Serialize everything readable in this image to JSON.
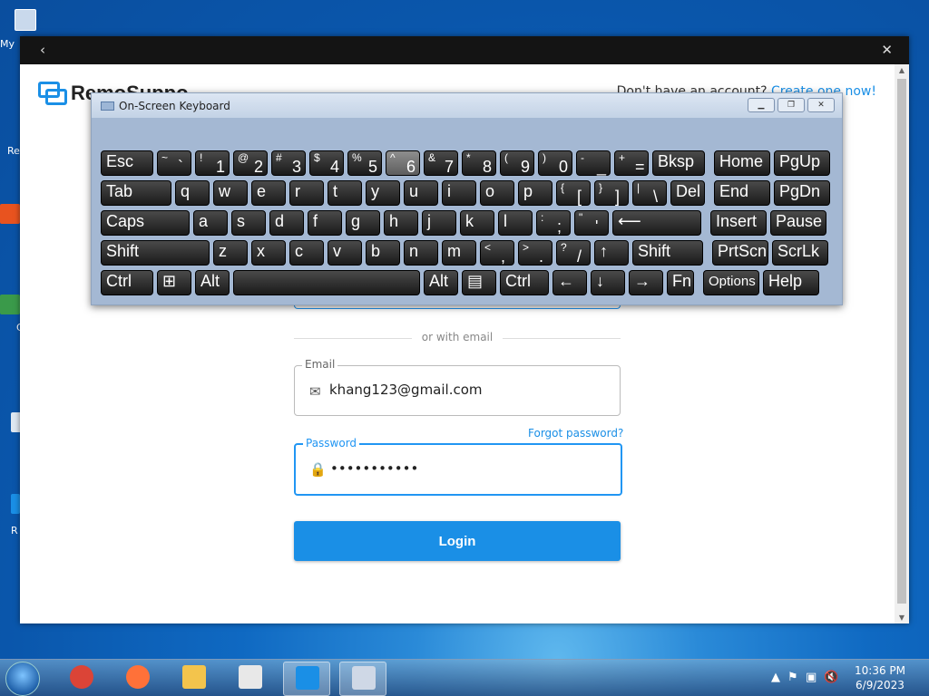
{
  "desktop": {
    "icons": [
      {
        "label": "My"
      },
      {
        "label": "Re"
      },
      {
        "label": ""
      },
      {
        "label": "C"
      },
      {
        "label": ""
      },
      {
        "label": "R"
      }
    ]
  },
  "app": {
    "back_glyph": "‹",
    "close_glyph": "✕",
    "brand": "RemoSuppo",
    "signup_prompt": "Don't have an account?",
    "signup_link": "Create one now!",
    "divider_text": "or with email",
    "email": {
      "label": "Email",
      "value": "khang123@gmail.com",
      "icon": "envelope-icon"
    },
    "forgot_password": "Forgot password?",
    "password": {
      "label": "Password",
      "value": "•••••••••••",
      "icon": "lock-icon"
    },
    "login_label": "Login",
    "accent_color": "#1a8fe6"
  },
  "osk": {
    "title": "On-Screen Keyboard",
    "rows": [
      [
        {
          "m": "Esc"
        },
        {
          "s": "~",
          "b": "`"
        },
        {
          "s": "!",
          "b": "1"
        },
        {
          "s": "@",
          "b": "2"
        },
        {
          "s": "#",
          "b": "3"
        },
        {
          "s": "$",
          "b": "4"
        },
        {
          "s": "%",
          "b": "5"
        },
        {
          "s": "^",
          "b": "6",
          "hover": true
        },
        {
          "s": "&",
          "b": "7"
        },
        {
          "s": "*",
          "b": "8"
        },
        {
          "s": "(",
          "b": "9"
        },
        {
          "s": ")",
          "b": "0"
        },
        {
          "s": "-",
          "b": "_"
        },
        {
          "s": "+",
          "b": "="
        },
        {
          "m": "Bksp"
        },
        {
          "m": "Home"
        },
        {
          "m": "PgUp"
        }
      ],
      [
        {
          "m": "Tab"
        },
        {
          "m": "q"
        },
        {
          "m": "w"
        },
        {
          "m": "e"
        },
        {
          "m": "r"
        },
        {
          "m": "t"
        },
        {
          "m": "y"
        },
        {
          "m": "u"
        },
        {
          "m": "i"
        },
        {
          "m": "o"
        },
        {
          "m": "p"
        },
        {
          "s": "{",
          "b": "["
        },
        {
          "s": "}",
          "b": "]"
        },
        {
          "s": "|",
          "b": "\\"
        },
        {
          "m": "Del"
        },
        {
          "m": "End"
        },
        {
          "m": "PgDn"
        }
      ],
      [
        {
          "m": "Caps"
        },
        {
          "m": "a"
        },
        {
          "m": "s"
        },
        {
          "m": "d"
        },
        {
          "m": "f"
        },
        {
          "m": "g"
        },
        {
          "m": "h"
        },
        {
          "m": "j"
        },
        {
          "m": "k"
        },
        {
          "m": "l"
        },
        {
          "s": ":",
          "b": ";"
        },
        {
          "s": "\"",
          "b": "'"
        },
        {
          "m": "⟵"
        },
        {
          "m": "Insert"
        },
        {
          "m": "Pause"
        }
      ],
      [
        {
          "m": "Shift"
        },
        {
          "m": "z"
        },
        {
          "m": "x"
        },
        {
          "m": "c"
        },
        {
          "m": "v"
        },
        {
          "m": "b"
        },
        {
          "m": "n"
        },
        {
          "m": "m"
        },
        {
          "s": "<",
          "b": ","
        },
        {
          "s": ">",
          "b": "."
        },
        {
          "s": "?",
          "b": "/"
        },
        {
          "m": "↑"
        },
        {
          "m": "Shift"
        },
        {
          "m": "PrtScn"
        },
        {
          "m": "ScrLk"
        }
      ],
      [
        {
          "m": "Ctrl"
        },
        {
          "m": "⊞"
        },
        {
          "m": "Alt"
        },
        {
          "m": ""
        },
        {
          "m": "Alt"
        },
        {
          "m": "▤"
        },
        {
          "m": "Ctrl"
        },
        {
          "m": "←"
        },
        {
          "m": "↓"
        },
        {
          "m": "→"
        },
        {
          "m": "Fn"
        },
        {
          "m": "Options",
          "small": true
        },
        {
          "m": "Help"
        }
      ]
    ]
  },
  "taskbar": {
    "apps": [
      {
        "name": "chrome",
        "color": "#db4437",
        "active": false
      },
      {
        "name": "firefox",
        "color": "#ff7139",
        "active": false
      },
      {
        "name": "explorer",
        "color": "#f3c44c",
        "active": false
      },
      {
        "name": "notepad",
        "color": "#e8e8e8",
        "active": false
      },
      {
        "name": "remosuppo",
        "color": "#1a8fe6",
        "active": true
      },
      {
        "name": "osk",
        "color": "#cfd8e6",
        "active": true
      }
    ],
    "time": "10:36 PM",
    "date": "6/9/2023"
  }
}
